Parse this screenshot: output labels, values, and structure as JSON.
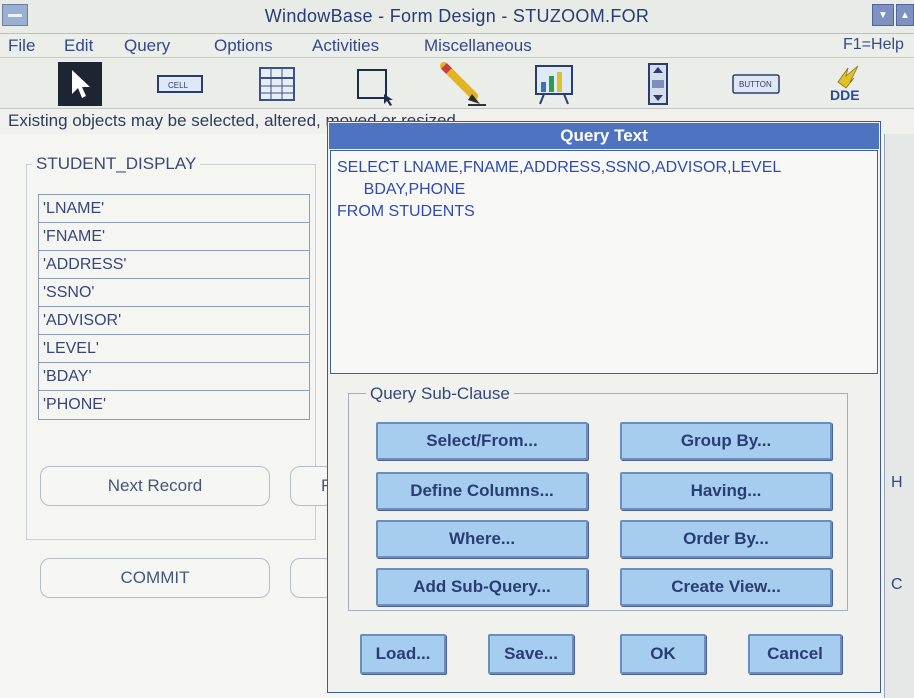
{
  "window": {
    "title": "WindowBase - Form Design - STUZOOM.FOR"
  },
  "menu": {
    "items": [
      "File",
      "Edit",
      "Query",
      "Options",
      "Activities",
      "Miscellaneous"
    ],
    "help": "F1=Help"
  },
  "toolbar": {
    "tools": [
      "pointer-tool",
      "cell-tool",
      "table-tool",
      "frame-tool",
      "pencil-tool",
      "chart-tool",
      "scrollbar-tool",
      "button-tool",
      "dde-tool"
    ],
    "cell_label": "CELL",
    "button_label": "BUTTON",
    "dde_label": "DDE"
  },
  "status": {
    "text": "Existing objects may be selected, altered, moved or resized"
  },
  "form": {
    "group_title": "STUDENT_DISPLAY",
    "fields": [
      "'LNAME'",
      "'FNAME'",
      "'ADDRESS'",
      "'SSNO'",
      "'ADVISOR'",
      "'LEVEL'",
      "'BDAY'",
      "'PHONE'"
    ],
    "next_record": "Next Record",
    "commit": "COMMIT",
    "partial_button_1": "F"
  },
  "dialog": {
    "title": "Query Text",
    "query": "SELECT LNAME,FNAME,ADDRESS,SSNO,ADVISOR,LEVEL\n      BDAY,PHONE\nFROM STUDENTS",
    "subclause_title": "Query Sub-Clause",
    "buttons": {
      "select_from": "Select/From...",
      "group_by": "Group By...",
      "define_columns": "Define Columns...",
      "having": "Having...",
      "where": "Where...",
      "order_by": "Order By...",
      "add_subquery": "Add Sub-Query...",
      "create_view": "Create View...",
      "load": "Load...",
      "save": "Save...",
      "ok": "OK",
      "cancel": "Cancel"
    }
  },
  "background": {
    "right_edge_h": "H",
    "right_edge_c": "C"
  },
  "colors": {
    "dialog_title": "#4d73c1",
    "button_face": "#a6cdf0",
    "query_text": "#2d4bb3"
  }
}
